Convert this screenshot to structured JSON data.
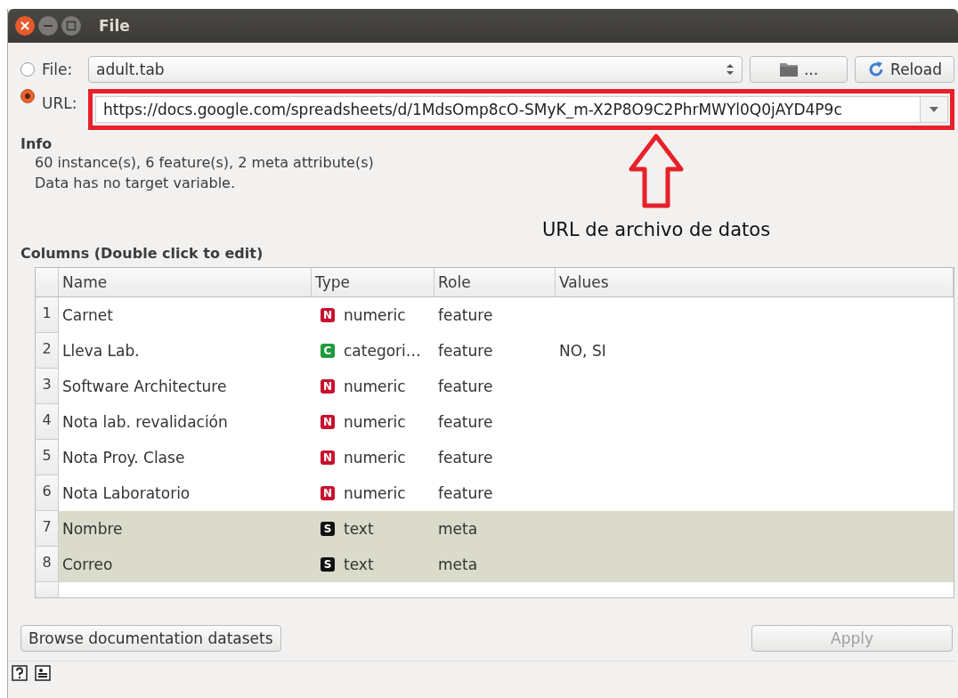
{
  "window": {
    "title": "File"
  },
  "source": {
    "file": {
      "label": "File:",
      "selected": false,
      "value": "adult.tab",
      "browse_label": "...",
      "reload_label": "Reload"
    },
    "url": {
      "label": "URL:",
      "selected": true,
      "value": "https://docs.google.com/spreadsheets/d/1MdsOmp8cO-SMyK_m-X2P8O9C2PhrMWYl0Q0jAYD4P9c"
    }
  },
  "annotation": {
    "label": "URL de archivo de datos"
  },
  "info": {
    "title": "Info",
    "lines": [
      "60 instance(s), 6 feature(s), 2 meta attribute(s)",
      "Data has no target variable."
    ]
  },
  "columns": {
    "title": "Columns (Double click to edit)",
    "headers": [
      "Name",
      "Type",
      "Role",
      "Values"
    ],
    "rows": [
      {
        "index": "1",
        "name": "Carnet",
        "type_badge": "N",
        "color": "#c8102e",
        "type": "numeric",
        "role": "feature",
        "kind": "feature"
      },
      {
        "index": "2",
        "name": "Lleva Lab.",
        "type_badge": "C",
        "color": "#1f9a3c",
        "type": "categori…",
        "role": "feature",
        "values": "NO, SI",
        "kind": "feature"
      },
      {
        "index": "3",
        "name": "Software Architecture",
        "type_badge": "N",
        "color": "#c8102e",
        "type": "numeric",
        "role": "feature",
        "kind": "feature"
      },
      {
        "index": "4",
        "name": "Nota lab. revalidación",
        "type_badge": "N",
        "color": "#c8102e",
        "type": "numeric",
        "role": "feature",
        "kind": "feature"
      },
      {
        "index": "5",
        "name": "Nota Proy. Clase",
        "type_badge": "N",
        "color": "#c8102e",
        "type": "numeric",
        "role": "feature",
        "kind": "feature"
      },
      {
        "index": "6",
        "name": "Nota Laboratorio",
        "type_badge": "N",
        "color": "#c8102e",
        "type": "numeric",
        "role": "feature",
        "kind": "feature"
      },
      {
        "index": "7",
        "name": "Nombre",
        "type_badge": "S",
        "color": "#111111",
        "type": "text",
        "role": "meta",
        "kind": "meta"
      },
      {
        "index": "8",
        "name": "Correo",
        "type_badge": "S",
        "color": "#111111",
        "type": "text",
        "role": "meta",
        "kind": "meta"
      }
    ]
  },
  "buttons": {
    "browse": {
      "label": "Browse documentation datasets"
    },
    "apply": {
      "label": "Apply",
      "disabled": true
    }
  }
}
